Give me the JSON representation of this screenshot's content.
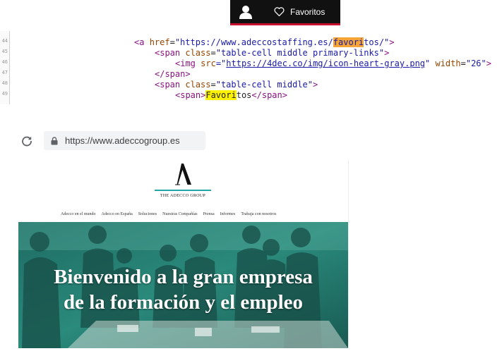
{
  "topbar": {
    "favorites_label": "Favoritos",
    "user_icon": "user-icon",
    "heart_icon": "heart-outline-icon",
    "accent_color": "#c8102e"
  },
  "code": {
    "line_numbers": [
      "44",
      "45",
      "46",
      "47",
      "48",
      "49"
    ],
    "l1": {
      "open": "<a ",
      "attr": "href",
      "eq": "=",
      "url_start": "\"https://www.adeccostaffing.es/",
      "url_hl": "favori",
      "url_end": "tos/\"",
      "close": ">"
    },
    "l2": {
      "open": "<span ",
      "attr": "class",
      "eq": "=",
      "val": "\"table-cell middle primary-links\"",
      "close": ">"
    },
    "l3": {
      "open": "<img ",
      "attr1": "src",
      "eq1": "=\"",
      "link": "https://4dec.co/img/icon-heart-gray.png",
      "q": "\" ",
      "attr2": "width",
      "eq2": "=",
      "val2": "\"26\"",
      "close": ">"
    },
    "l4": {
      "text": "</span>"
    },
    "l5": {
      "open": "<span ",
      "attr": "class",
      "eq": "=",
      "val": "\"table-cell middle\"",
      "close": ">"
    },
    "l6": {
      "open": "<span>",
      "hl": "Favori",
      "rest": "tos",
      "close": "</span>"
    }
  },
  "browser": {
    "url": "https://www.adeccogroup.es",
    "reload_icon": "reload-icon",
    "lock_icon": "lock-icon"
  },
  "site": {
    "logo_letter": "A",
    "logo_text": "THE ADECCO GROUP",
    "nav": [
      "Adecco en el mundo",
      "Adecco en España",
      "Soluciones",
      "Nuestras Compañías",
      "Prensa",
      "Informes",
      "Trabaja con nosotros"
    ],
    "hero_line1": "Bienvenido a la gran empresa",
    "hero_line2": "de la formación y el empleo",
    "accent_color": "#1fa7a7"
  }
}
